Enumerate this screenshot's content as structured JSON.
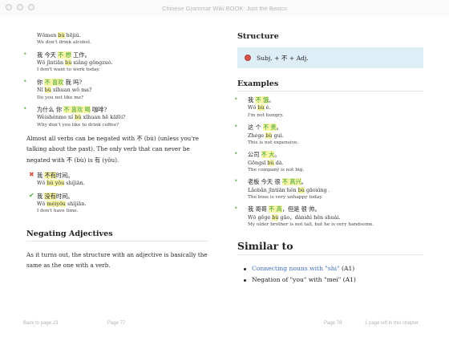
{
  "window": {
    "title": "Chinese Grammar Wiki BOOK: Just the Basics"
  },
  "left_page": {
    "top_example": {
      "hanzi": "",
      "pinyin_pre": "Wǒmen ",
      "pinyin_hl": "bù",
      "pinyin_post": " hējiǔ.",
      "translation": "We don't drink alcohol."
    },
    "examples": [
      {
        "hanzi_pre": "我 今天 ",
        "hanzi_hl": "不 想",
        "hanzi_post": " 工作。",
        "pinyin_pre": "Wǒ jīntiān ",
        "pinyin_hl": "bù",
        "pinyin_post": " xiǎng gōngzuò.",
        "translation": "I don't want to work today."
      },
      {
        "hanzi_pre": "你 ",
        "hanzi_hl": "不 喜欢",
        "hanzi_post": " 我 吗?",
        "pinyin_pre": "Nǐ ",
        "pinyin_hl": "bù",
        "pinyin_post": " xǐhuan wǒ ma?",
        "translation": "Do you not like me?"
      },
      {
        "hanzi_pre": "为什么 你 ",
        "hanzi_hl": "不 喜欢 喝",
        "hanzi_post": " 咖啡?",
        "pinyin_pre": "Wèishénme nǐ ",
        "pinyin_hl": "bù",
        "pinyin_post": " xǐhuan hē kāfēi?",
        "translation": "Why don't you like to drink coffee?"
      }
    ],
    "paragraph1": "Almost all verbs can be negated with 不 (bù) (unless you're talking about the past). The only verb that can never be negated with 不 (bù) is 有 (yǒu).",
    "wrong_example": {
      "hanzi_pre": "我 ",
      "hanzi_hl": "不有",
      "hanzi_post": "时间。",
      "pinyin_pre": "Wǒ ",
      "pinyin_hl": "bù yǒu",
      "pinyin_post": " shíjiān."
    },
    "right_example": {
      "hanzi_pre": "我 ",
      "hanzi_hl": "没有",
      "hanzi_post": "时间。",
      "pinyin_pre": "Wǒ ",
      "pinyin_hl": "méiyǒu",
      "pinyin_post": " shíjiān.",
      "translation": "I don't have time."
    },
    "section_heading": "Negating Adjectives",
    "paragraph2": "As it turns out, the structure with an adjective is basically the same as the one with a verb."
  },
  "right_page": {
    "structure_heading": "Structure",
    "structure_formula": "Subj. + 不 + Adj.",
    "examples_heading": "Examples",
    "examples": [
      {
        "hanzi_pre": "我 ",
        "hanzi_hl": "不 饿",
        "hanzi_post": "。",
        "pinyin_pre": "Wǒ ",
        "pinyin_hl": "bù",
        "pinyin_post": " è.",
        "translation": "I'm not hungry."
      },
      {
        "hanzi_pre": "这 个 ",
        "hanzi_hl": "不 贵",
        "hanzi_post": "。",
        "pinyin_pre": "Zhège ",
        "pinyin_hl": "bù",
        "pinyin_post": " guì.",
        "translation": "This is not expensive."
      },
      {
        "hanzi_pre": "公司 ",
        "hanzi_hl": "不 大",
        "hanzi_post": "。",
        "pinyin_pre": "Gōngsī ",
        "pinyin_hl": "bù",
        "pinyin_post": " dà.",
        "translation": "The company is not big."
      },
      {
        "hanzi_pre": "老板 今天 很 ",
        "hanzi_hl": "不 高兴",
        "hanzi_post": "。",
        "pinyin_pre": "Lǎobǎn jīntiān hěn ",
        "pinyin_hl": "bù",
        "pinyin_post": " gāoxìng .",
        "translation": "The boss is very unhappy today."
      },
      {
        "hanzi_pre": "我 哥哥 ",
        "hanzi_hl": "不 高",
        "hanzi_post": "，但是 很 帅。",
        "pinyin_pre": "Wǒ gēge ",
        "pinyin_hl": "bù",
        "pinyin_post": " gāo，dànshì hěn shuài.",
        "translation": "My older brother is not tall, but he is very handsome."
      }
    ],
    "similar_heading": "Similar to",
    "similar_items": [
      {
        "link": "Connecting nouns with \"shi\"",
        "suffix": " (A1)"
      },
      {
        "text": "Negation of \"you\" with \"mei\" (A1)"
      }
    ]
  },
  "footer": {
    "back": "Back to page 23",
    "left_page_num": "Page 77",
    "right_page_num": "Page 78",
    "pages_left": "1 page left in this chapter"
  }
}
